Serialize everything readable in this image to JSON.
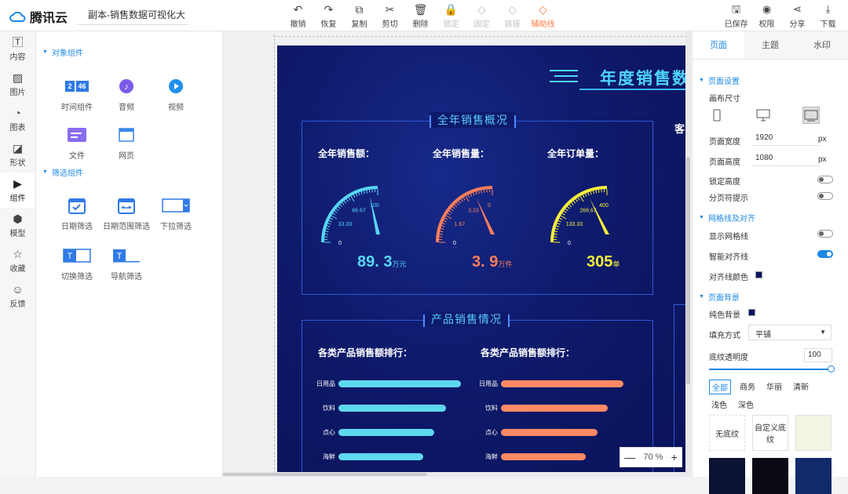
{
  "app": {
    "brand": "腾讯云",
    "doc_title": "副本-销售数据可视化大"
  },
  "toolbar": [
    {
      "label": "撤销",
      "icon": "undo-icon",
      "glyph": "↶",
      "state": "normal"
    },
    {
      "label": "恢复",
      "icon": "redo-icon",
      "glyph": "↷",
      "state": "normal"
    },
    {
      "label": "复制",
      "icon": "copy-icon",
      "glyph": "⧉",
      "state": "normal"
    },
    {
      "label": "剪切",
      "icon": "cut-icon",
      "glyph": "✂",
      "state": "normal"
    },
    {
      "label": "删除",
      "icon": "delete-icon",
      "glyph": "🗑",
      "state": "normal"
    },
    {
      "label": "锁定",
      "icon": "lock-icon",
      "glyph": "🔒",
      "state": "disabled"
    },
    {
      "label": "固定",
      "icon": "pin-icon",
      "glyph": "◇",
      "state": "disabled"
    },
    {
      "label": "链接",
      "icon": "link-icon",
      "glyph": "◇",
      "state": "disabled"
    },
    {
      "label": "辅助线",
      "icon": "guide-icon",
      "glyph": "◇",
      "state": "active"
    }
  ],
  "right_toolbar": [
    {
      "label": "已保存",
      "icon": "save-icon",
      "glyph": "🖫"
    },
    {
      "label": "权限",
      "icon": "eye-icon",
      "glyph": "◉"
    },
    {
      "label": "分享",
      "icon": "share-icon",
      "glyph": "⋖"
    },
    {
      "label": "下载",
      "icon": "download-icon",
      "glyph": "⤓"
    }
  ],
  "left_nav": [
    {
      "label": "内容",
      "icon": "text-icon",
      "glyph": "🅃"
    },
    {
      "label": "图片",
      "icon": "image-icon",
      "glyph": "▨"
    },
    {
      "label": "图表",
      "icon": "chart-icon",
      "glyph": "◔"
    },
    {
      "label": "形状",
      "icon": "shape-icon",
      "glyph": "◪"
    },
    {
      "label": "组件",
      "icon": "component-icon",
      "glyph": "▶"
    },
    {
      "label": "模型",
      "icon": "model-icon",
      "glyph": "⬢"
    },
    {
      "label": "收藏",
      "icon": "star-icon",
      "glyph": "☆"
    },
    {
      "label": "反馈",
      "icon": "feedback-icon",
      "glyph": "☺"
    }
  ],
  "component_panel": {
    "section1": "对象组件",
    "section1_items": [
      "时间组件",
      "音频",
      "视频",
      "文件",
      "网页"
    ],
    "section2": "筛选组件",
    "section2_items": [
      "日期筛选",
      "日期范围筛选",
      "下拉筛选",
      "切换筛选",
      "导航筛选"
    ],
    "time_icon_text": [
      "2",
      "46"
    ]
  },
  "board": {
    "title": "年度销售数",
    "client_label": "客",
    "box1_title": "全年销售概况",
    "box2_title": "产品销售情况",
    "stats": [
      {
        "label": "全年销售额：",
        "value": "89. 3",
        "unit": "万元",
        "color": "#58d6f5",
        "ticks": [
          "0",
          "33.33",
          "66.67",
          "100"
        ],
        "level": 0.893
      },
      {
        "label": "全年销售量：",
        "value": "3. 9",
        "unit": "万件",
        "color": "#ff7e5a",
        "ticks": [
          "0",
          "1.67",
          "3.33",
          "5"
        ],
        "level": 0.78
      },
      {
        "label": "全年订单量：",
        "value": "305",
        "unit": "单",
        "color": "#f5f03a",
        "ticks": [
          "0",
          "133.33",
          "266.67",
          "400"
        ],
        "level": 0.7625
      }
    ],
    "bar_charts": [
      {
        "title": "各类产品销售额排行：",
        "color": "#5ed8ef",
        "categories": [
          "日用品",
          "饮料",
          "点心",
          "海鲜"
        ],
        "values": [
          1.0,
          0.88,
          0.78,
          0.69
        ]
      },
      {
        "title": "各类产品销售额排行：",
        "color": "#ff8a65",
        "categories": [
          "日用品",
          "饮料",
          "点心",
          "海鲜"
        ],
        "values": [
          1.0,
          0.87,
          0.79,
          0.69
        ]
      }
    ]
  },
  "zoom": {
    "value": "70",
    "unit": "%",
    "minus": "—",
    "plus": "+"
  },
  "right_panel": {
    "tabs": [
      "页面",
      "主题",
      "水印"
    ],
    "page_settings": "页面设置",
    "canvas_size": "画布尺寸",
    "width_label": "页面宽度",
    "width_value": "1920",
    "unit": "px",
    "height_label": "页面高度",
    "height_value": "1080",
    "lock_height": "锁定高度",
    "page_break": "分页符提示",
    "grid_section": "网格线及对齐",
    "show_grid": "显示网格线",
    "smart_align": "智能对齐线",
    "align_color": "对齐线颜色",
    "bg_section": "页面背景",
    "solid_bg": "纯色背景",
    "fill_mode_label": "填充方式",
    "fill_mode_value": "平铺",
    "texture_opacity_label": "底纹透明度",
    "texture_opacity_value": "100",
    "filters": [
      "全部",
      "商务",
      "华丽",
      "清新",
      "浅色",
      "深色"
    ],
    "textures": [
      "无底纹",
      "自定义底纹"
    ],
    "swatch_color": "#0b1460",
    "accent": "#1e88e5"
  }
}
